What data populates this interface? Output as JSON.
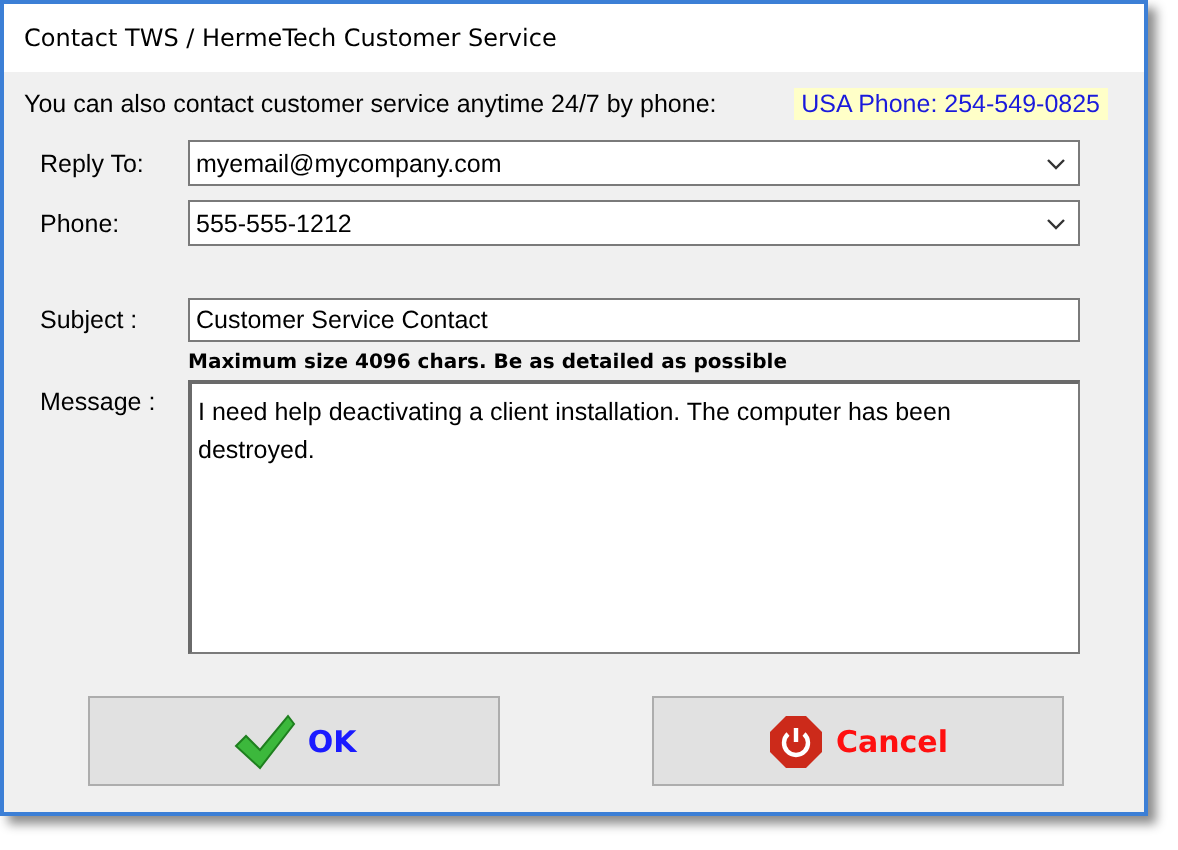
{
  "window": {
    "title": "Contact TWS / HermeTech Customer Service"
  },
  "info": {
    "text": "You can also contact customer service anytime 24/7 by phone:",
    "phone": "USA Phone: 254-549-0825"
  },
  "fields": [
    {
      "kind": "combo",
      "label": "Reply To:",
      "value": "myemail@mycompany.com"
    },
    {
      "kind": "combo",
      "label": "Phone:",
      "value": "555-555-1212"
    }
  ],
  "subject": {
    "label": "Subject :",
    "value": "Customer Service Contact"
  },
  "message": {
    "label": "Message :",
    "note": "Maximum size 4096 chars. Be as detailed as possible",
    "value": "I need help deactivating a client installation. The computer has been destroyed."
  },
  "buttons": [
    {
      "kind": "ok",
      "label": "OK"
    },
    {
      "kind": "cancel",
      "label": "Cancel"
    }
  ]
}
